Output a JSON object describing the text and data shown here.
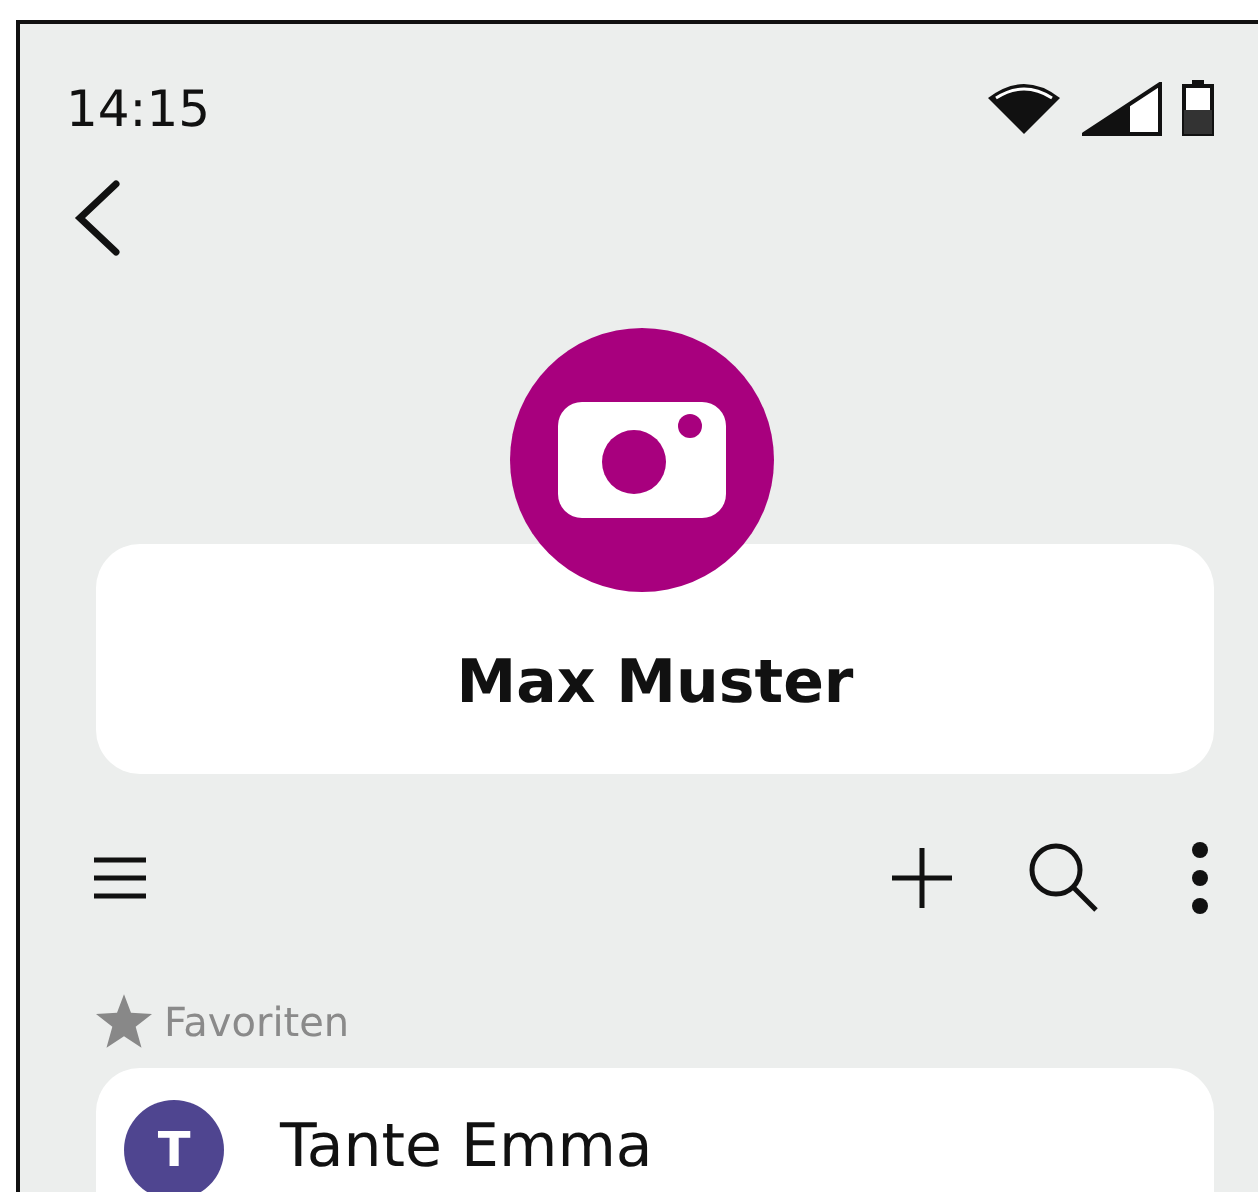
{
  "status_bar": {
    "time": "14:15"
  },
  "profile": {
    "name": "Max Muster"
  },
  "section": {
    "title": "Favoriten"
  },
  "contacts": [
    {
      "initial": "T",
      "name": "Tante Emma",
      "color": "#4f4590"
    }
  ]
}
